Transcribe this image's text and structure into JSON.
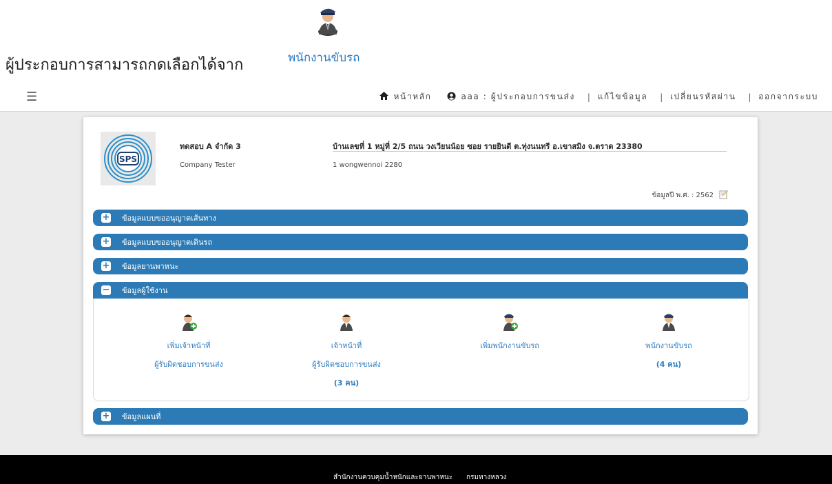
{
  "hint": {
    "text": "ผู้ประกอบการสามารถกดเลือกได้จาก",
    "link": "พนักงานขับรถ",
    "icon": "driver-icon"
  },
  "nav": {
    "menu_icon": "☰",
    "home": "หน้าหลัก",
    "user": "aaa : ผู้ประกอบการขนส่ง",
    "edit": "แก้ไขข้อมูล",
    "password": "เปลี่ยนรหัสผ่าน",
    "logout": "ออกจากระบบ",
    "separator": "|"
  },
  "company": {
    "logo_text": "SPS",
    "name": "ทดสอบ A จำกัด 3",
    "name_en": "Company Tester",
    "address": "บ้านเลขที่ 1 หมู่ที่ 2/5 ถนน วงเวียนน้อย ซอย รายยินดี ต.ทุ่งนนทรี อ.เขาสมิง จ.ตราด 23380",
    "address_en": "1 wongwennoi 2280",
    "year_label": "ข้อมูลปี พ.ศ. : 2562"
  },
  "sections": [
    {
      "label": "ข้อมูลแบบขออนุญาตเส้นทาง",
      "toggle": "+"
    },
    {
      "label": "ข้อมูลแบบขออนุญาตเดินรถ",
      "toggle": "+"
    },
    {
      "label": "ข้อมูลยานพาหนะ",
      "toggle": "+"
    },
    {
      "label": "ข้อมูลผู้ใช้งาน",
      "toggle": "−"
    },
    {
      "label": "ข้อมูลแผนที่",
      "toggle": "+"
    }
  ],
  "users": [
    {
      "line1": "เพิ่มเจ้าหน้าที่",
      "line2": "ผู้รับผิดชอบการขนส่ง",
      "count": "",
      "icon": "add-officer-icon"
    },
    {
      "line1": "เจ้าหน้าที่",
      "line2": "ผู้รับผิดชอบการขนส่ง",
      "count": "(3 คน)",
      "icon": "officer-icon"
    },
    {
      "line1": "เพิ่มพนักงานขับรถ",
      "line2": "",
      "count": "",
      "icon": "add-driver-icon"
    },
    {
      "line1": "พนักงานขับรถ",
      "line2": "(4 คน)",
      "count": "",
      "icon": "driver-icon"
    }
  ],
  "footer": {
    "agency": "สำนักงานควบคุมน้ำหนักและยานพาหนะ",
    "dept": "กรมทางหลวง"
  },
  "colors": {
    "accent": "#2c7bb6",
    "link": "#2d7cc1",
    "background": "#ececec",
    "footer": "#000000"
  }
}
